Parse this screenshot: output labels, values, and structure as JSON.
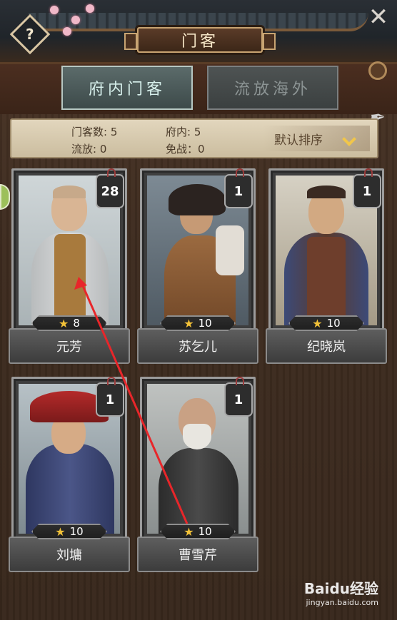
{
  "header": {
    "title": "门客",
    "help_label": "?",
    "close_label": "✕"
  },
  "tabs": [
    {
      "label": "府内门客",
      "active": true
    },
    {
      "label": "流放海外",
      "active": false
    }
  ],
  "stats": {
    "retainers": "门客数: 5",
    "inside": "府内: 5",
    "exiled": "流放: 0",
    "exempt": "免战：0"
  },
  "sort": {
    "label": "默认排序"
  },
  "cards": [
    {
      "name": "元芳",
      "stars": "8",
      "level": "28"
    },
    {
      "name": "苏乞儿",
      "stars": "10",
      "level": "1"
    },
    {
      "name": "纪晓岚",
      "stars": "10",
      "level": "1"
    },
    {
      "name": "刘墉",
      "stars": "10",
      "level": "1"
    },
    {
      "name": "曹雪芹",
      "stars": "10",
      "level": "1"
    }
  ],
  "watermark": {
    "brand": "Baidu经验",
    "url": "jingyan.baidu.com"
  },
  "colors": {
    "accent_star": "#f3c238",
    "annotation_arrow": "#e8262a",
    "active_tab_text": "#d7f0ec"
  },
  "icons": [
    "question-icon",
    "close-icon",
    "chevron-down-icon",
    "star-icon",
    "brush-icon",
    "coin-icon"
  ]
}
